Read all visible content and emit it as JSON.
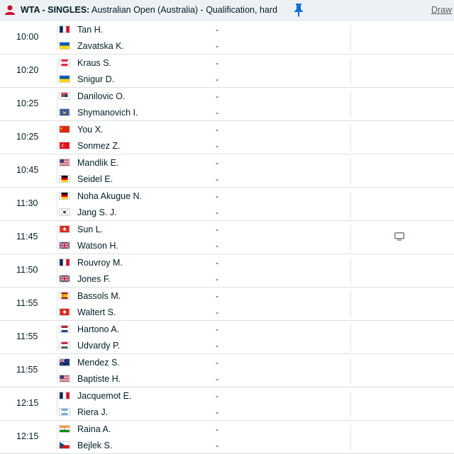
{
  "header": {
    "category": "WTA - SINGLES:",
    "tournament": "Australian Open (Australia) - Qualification, hard",
    "draw_label": "Draw"
  },
  "matches": [
    {
      "time": "10:00",
      "p1": {
        "name": "Tan H.",
        "flag": "fr",
        "score": "-"
      },
      "p2": {
        "name": "Zavatska K.",
        "flag": "ua",
        "score": "-"
      },
      "tv": false
    },
    {
      "time": "10:20",
      "p1": {
        "name": "Kraus S.",
        "flag": "at",
        "score": "-"
      },
      "p2": {
        "name": "Snigur D.",
        "flag": "ua",
        "score": "-"
      },
      "tv": false
    },
    {
      "time": "10:25",
      "p1": {
        "name": "Danilovic O.",
        "flag": "rs",
        "score": "-"
      },
      "p2": {
        "name": "Shymanovich I.",
        "flag": "neutral",
        "score": "-"
      },
      "tv": false
    },
    {
      "time": "10:25",
      "p1": {
        "name": "You X.",
        "flag": "cn",
        "score": "-"
      },
      "p2": {
        "name": "Sonmez Z.",
        "flag": "tr",
        "score": "-"
      },
      "tv": false
    },
    {
      "time": "10:45",
      "p1": {
        "name": "Mandlik E.",
        "flag": "us",
        "score": "-"
      },
      "p2": {
        "name": "Seidel E.",
        "flag": "de",
        "score": "-"
      },
      "tv": false
    },
    {
      "time": "11:30",
      "p1": {
        "name": "Noha Akugue N.",
        "flag": "de",
        "score": "-"
      },
      "p2": {
        "name": "Jang S. J.",
        "flag": "kr",
        "score": "-"
      },
      "tv": false
    },
    {
      "time": "11:45",
      "p1": {
        "name": "Sun L.",
        "flag": "ch",
        "score": "-"
      },
      "p2": {
        "name": "Watson H.",
        "flag": "gb",
        "score": "-"
      },
      "tv": true
    },
    {
      "time": "11:50",
      "p1": {
        "name": "Rouvroy M.",
        "flag": "fr",
        "score": "-"
      },
      "p2": {
        "name": "Jones F.",
        "flag": "gb",
        "score": "-"
      },
      "tv": false
    },
    {
      "time": "11:55",
      "p1": {
        "name": "Bassols M.",
        "flag": "es",
        "score": "-"
      },
      "p2": {
        "name": "Waltert S.",
        "flag": "ch",
        "score": "-"
      },
      "tv": false
    },
    {
      "time": "11:55",
      "p1": {
        "name": "Hartono A.",
        "flag": "nl",
        "score": "-"
      },
      "p2": {
        "name": "Udvardy P.",
        "flag": "hu",
        "score": "-"
      },
      "tv": false
    },
    {
      "time": "11:55",
      "p1": {
        "name": "Mendez S.",
        "flag": "au",
        "score": "-"
      },
      "p2": {
        "name": "Baptiste H.",
        "flag": "us",
        "score": "-"
      },
      "tv": false
    },
    {
      "time": "12:15",
      "p1": {
        "name": "Jacquemot E.",
        "flag": "fr",
        "score": "-"
      },
      "p2": {
        "name": "Riera J.",
        "flag": "ar",
        "score": "-"
      },
      "tv": false
    },
    {
      "time": "12:15",
      "p1": {
        "name": "Raina A.",
        "flag": "in",
        "score": "-"
      },
      "p2": {
        "name": "Bejlek S.",
        "flag": "cz",
        "score": "-"
      },
      "tv": false
    }
  ],
  "colors": {
    "accent": "#c8102e",
    "pin": "#0a74d9",
    "header_bg": "#eef1f3",
    "divider": "#dcdfe1"
  }
}
